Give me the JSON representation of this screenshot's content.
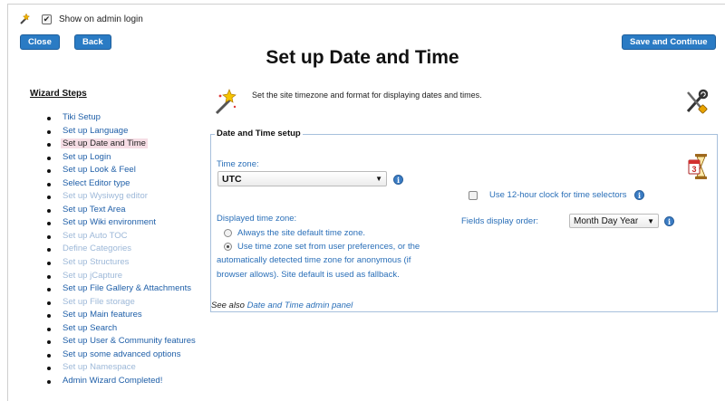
{
  "topbar": {
    "show_on_admin_login": "Show on admin login",
    "checked": "✔"
  },
  "buttons": {
    "close": "Close",
    "back": "Back",
    "save_continue": "Save and Continue"
  },
  "page_title": "Set up Date and Time",
  "wizard": {
    "title": "Wizard Steps",
    "steps": [
      {
        "label": "Tiki Setup",
        "state": "enabled"
      },
      {
        "label": "Set up Language",
        "state": "enabled"
      },
      {
        "label": "Set up Date and Time",
        "state": "current"
      },
      {
        "label": "Set up Login",
        "state": "enabled"
      },
      {
        "label": "Set up Look & Feel",
        "state": "enabled"
      },
      {
        "label": "Select Editor type",
        "state": "enabled"
      },
      {
        "label": "Set up Wysiwyg editor",
        "state": "disabled"
      },
      {
        "label": "Set up Text Area",
        "state": "enabled"
      },
      {
        "label": "Set up Wiki environment",
        "state": "enabled"
      },
      {
        "label": "Set up Auto TOC",
        "state": "disabled"
      },
      {
        "label": "Define Categories",
        "state": "disabled"
      },
      {
        "label": "Set up Structures",
        "state": "disabled"
      },
      {
        "label": "Set up jCapture",
        "state": "disabled"
      },
      {
        "label": "Set up File Gallery & Attachments",
        "state": "enabled"
      },
      {
        "label": "Set up File storage",
        "state": "disabled"
      },
      {
        "label": "Set up Main features",
        "state": "enabled"
      },
      {
        "label": "Set up Search",
        "state": "enabled"
      },
      {
        "label": "Set up User & Community features",
        "state": "enabled"
      },
      {
        "label": "Set up some advanced options",
        "state": "enabled"
      },
      {
        "label": "Set up Namespace",
        "state": "disabled"
      },
      {
        "label": "Admin Wizard Completed!",
        "state": "enabled"
      }
    ]
  },
  "intro": "Set the site timezone and format for displaying dates and times.",
  "fieldset": {
    "legend": "Date and Time setup",
    "timezone_label": "Time zone:",
    "timezone_value": "UTC",
    "clock12_label": "Use 12-hour clock for time selectors",
    "displayed_tz_label": "Displayed time zone:",
    "radio_default": "Always the site default time zone.",
    "radio_user_line1": "Use time zone set from user preferences, or the",
    "radio_user_line2": "automatically detected time zone for anonymous (if",
    "radio_user_line3": "browser allows). Site default is used as fallback.",
    "fields_order_label": "Fields display order:",
    "fields_order_value": "Month Day Year",
    "see_also_prefix": "See also",
    "see_also_link": "Date and Time admin panel"
  },
  "colors": {
    "accent": "#2a7bc4",
    "link": "#2a6fb8",
    "disabled": "#9db8d8",
    "current_highlight": "#f6dde5"
  },
  "icons": {
    "wand": "magic-wand-icon",
    "tools": "tools-icon",
    "hourglass": "hourglass-calendar-icon",
    "info": "info-icon"
  }
}
